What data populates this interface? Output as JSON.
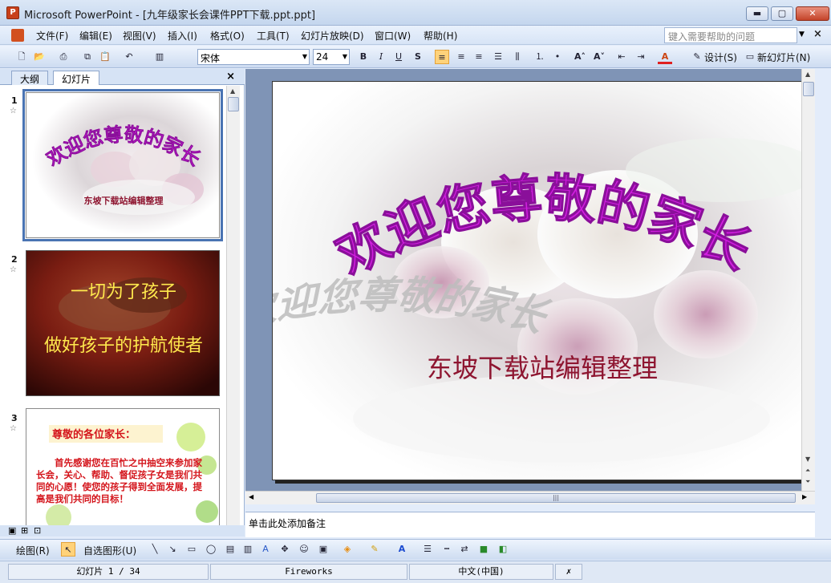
{
  "window": {
    "title": "Microsoft PowerPoint - [九年级家长会课件PPT下载.ppt.ppt]",
    "min": "▬",
    "max": "▢",
    "close": "✕"
  },
  "menu": {
    "items": [
      "文件(F)",
      "编辑(E)",
      "视图(V)",
      "插入(I)",
      "格式(O)",
      "工具(T)",
      "幻灯片放映(D)",
      "窗口(W)",
      "帮助(H)"
    ],
    "help_placeholder": "键入需要帮助的问题"
  },
  "toolbar": {
    "font_name": "宋体",
    "font_size": "24",
    "design_label": "设计(S)",
    "new_slide_label": "新幻灯片(N)"
  },
  "panel": {
    "tab_outline": "大纲",
    "tab_slides": "幻灯片",
    "close": "×",
    "slides": [
      {
        "num": "1",
        "title": "欢迎您尊敬的家长",
        "subtitle": "东坡下载站编辑整理"
      },
      {
        "num": "2",
        "line1": "一切为了孩子",
        "line2": "做好孩子的护航使者"
      },
      {
        "num": "3",
        "heading": "尊敬的各位家长：",
        "body": "首先感谢您在百忙之中抽空来参加家长会，关心、帮助、督促孩子女是我们共同的心愿！使您的孩子得到全面发展，提高是我们共同的目标！"
      }
    ]
  },
  "slide": {
    "title": "欢迎您尊敬的家长",
    "subtitle": "东坡下载站编辑整理"
  },
  "notes": {
    "placeholder": "单击此处添加备注"
  },
  "drawbar": {
    "draw_label": "绘图(R)",
    "autoshape_label": "自选图形(U)"
  },
  "status": {
    "slide_count": "幻灯片 1 / 34",
    "design": "Fireworks",
    "language": "中文(中国)"
  },
  "colors": {
    "title_magenta": "#d21ee0",
    "subtitle_red": "#8e1530",
    "thumb2_yellow": "#ffe94d",
    "thumb3_red": "#d4141b"
  }
}
